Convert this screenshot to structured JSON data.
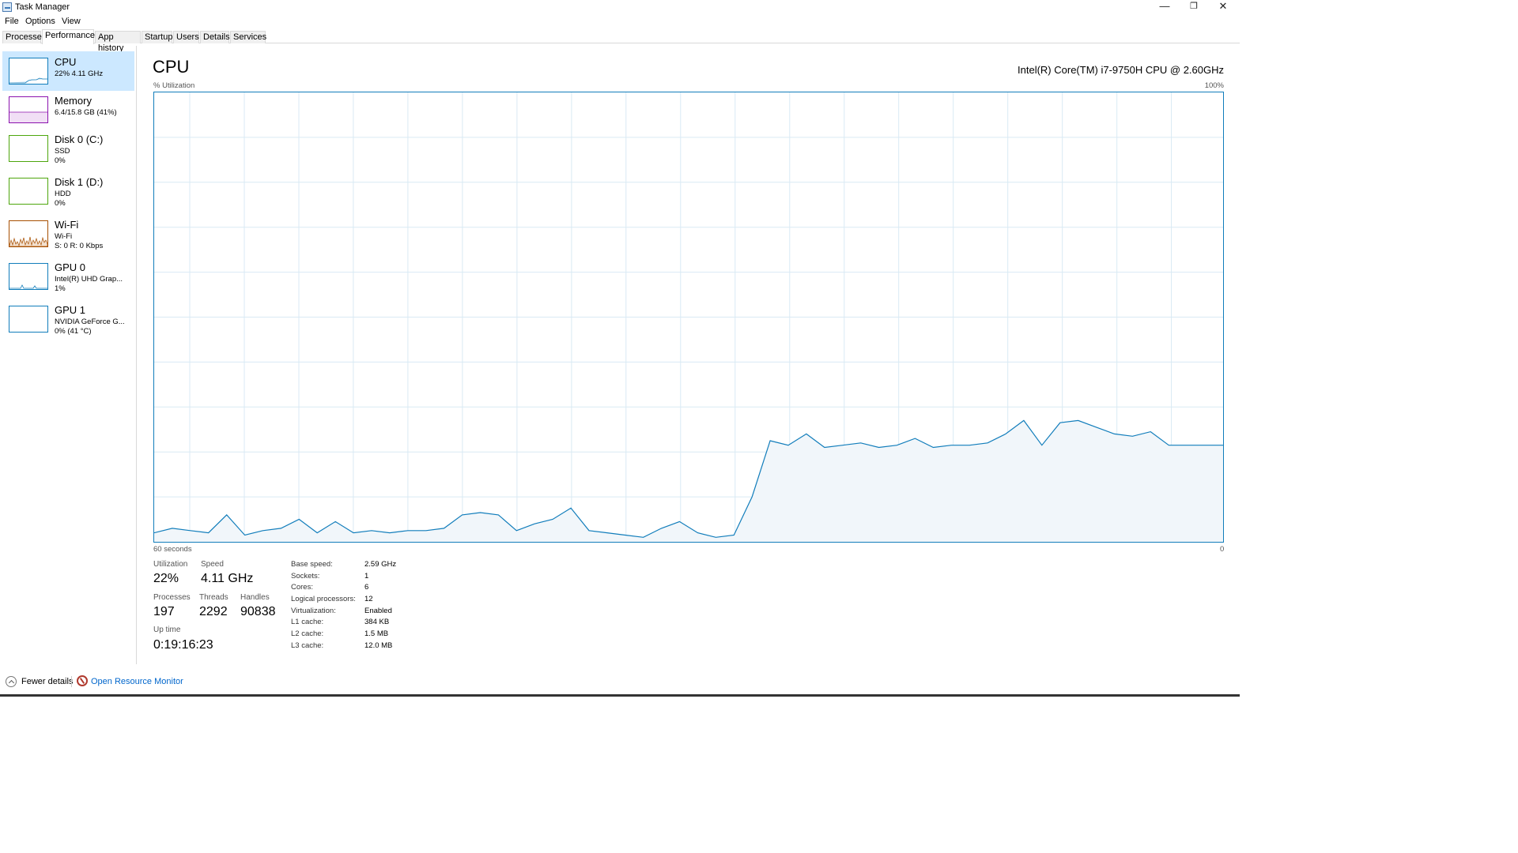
{
  "window": {
    "title": "Task Manager",
    "minimize": "—",
    "maximize": "❐",
    "close": "✕"
  },
  "menu": {
    "file": "File",
    "options": "Options",
    "view": "View"
  },
  "tabs": [
    "Processes",
    "Performance",
    "App history",
    "Startup",
    "Users",
    "Details",
    "Services"
  ],
  "active_tab": "Performance",
  "sidebar": [
    {
      "name": "CPU",
      "line1": "22% 4.11 GHz",
      "line2": "",
      "color": "#117dbb",
      "selected": true
    },
    {
      "name": "Memory",
      "line1": "6.4/15.8 GB (41%)",
      "line2": "",
      "color": "#8b12ae",
      "selected": false
    },
    {
      "name": "Disk 0 (C:)",
      "line1": "SSD",
      "line2": "0%",
      "color": "#4da60c",
      "selected": false
    },
    {
      "name": "Disk 1 (D:)",
      "line1": "HDD",
      "line2": "0%",
      "color": "#4da60c",
      "selected": false
    },
    {
      "name": "Wi-Fi",
      "line1": "Wi-Fi",
      "line2": "S: 0 R: 0 Kbps",
      "color": "#a74f01",
      "selected": false
    },
    {
      "name": "GPU 0",
      "line1": "Intel(R) UHD Grap...",
      "line2": "1%",
      "color": "#117dbb",
      "selected": false
    },
    {
      "name": "GPU 1",
      "line1": "NVIDIA GeForce G...",
      "line2": "0% (41 °C)",
      "color": "#117dbb",
      "selected": false
    }
  ],
  "main": {
    "title": "CPU",
    "cpu_model": "Intel(R) Core(TM) i7-9750H CPU @ 2.60GHz",
    "util_label": "% Utilization",
    "max_label": "100%",
    "time_label": "60 seconds",
    "zero_label": "0"
  },
  "chart_data": {
    "type": "area",
    "color": "#117dbb",
    "x_range": [
      60,
      0
    ],
    "ylim": [
      0,
      100
    ],
    "grid": true,
    "values": [
      2,
      3,
      2.5,
      2,
      6,
      1.5,
      2.5,
      3,
      5,
      2,
      4.5,
      2,
      2.5,
      2,
      2.5,
      2.5,
      3,
      6,
      6.5,
      6,
      2.5,
      4,
      5,
      7.5,
      2.5,
      2,
      1.5,
      1,
      3,
      4.5,
      2,
      1,
      1.5,
      10,
      22.5,
      21.5,
      24,
      21,
      21.5,
      22,
      21,
      21.5,
      23,
      21,
      21.5,
      21.5,
      22,
      24,
      27,
      21.5,
      26.5,
      27,
      25.5,
      24,
      23.5,
      24.5,
      21.5,
      21.5,
      21.5,
      21.5
    ]
  },
  "stats": {
    "utilization_label": "Utilization",
    "utilization": "22%",
    "speed_label": "Speed",
    "speed": "4.11 GHz",
    "processes_label": "Processes",
    "processes": "197",
    "threads_label": "Threads",
    "threads": "2292",
    "handles_label": "Handles",
    "handles": "90838",
    "uptime_label": "Up time",
    "uptime": "0:19:16:23"
  },
  "specs": [
    {
      "label": "Base speed:",
      "value": "2.59 GHz"
    },
    {
      "label": "Sockets:",
      "value": "1"
    },
    {
      "label": "Cores:",
      "value": "6"
    },
    {
      "label": "Logical processors:",
      "value": "12"
    },
    {
      "label": "Virtualization:",
      "value": "Enabled"
    },
    {
      "label": "L1 cache:",
      "value": "384 KB"
    },
    {
      "label": "L2 cache:",
      "value": "1.5 MB"
    },
    {
      "label": "L3 cache:",
      "value": "12.0 MB"
    }
  ],
  "footer": {
    "fewer_details": "Fewer details",
    "resource_monitor": "Open Resource Monitor"
  }
}
